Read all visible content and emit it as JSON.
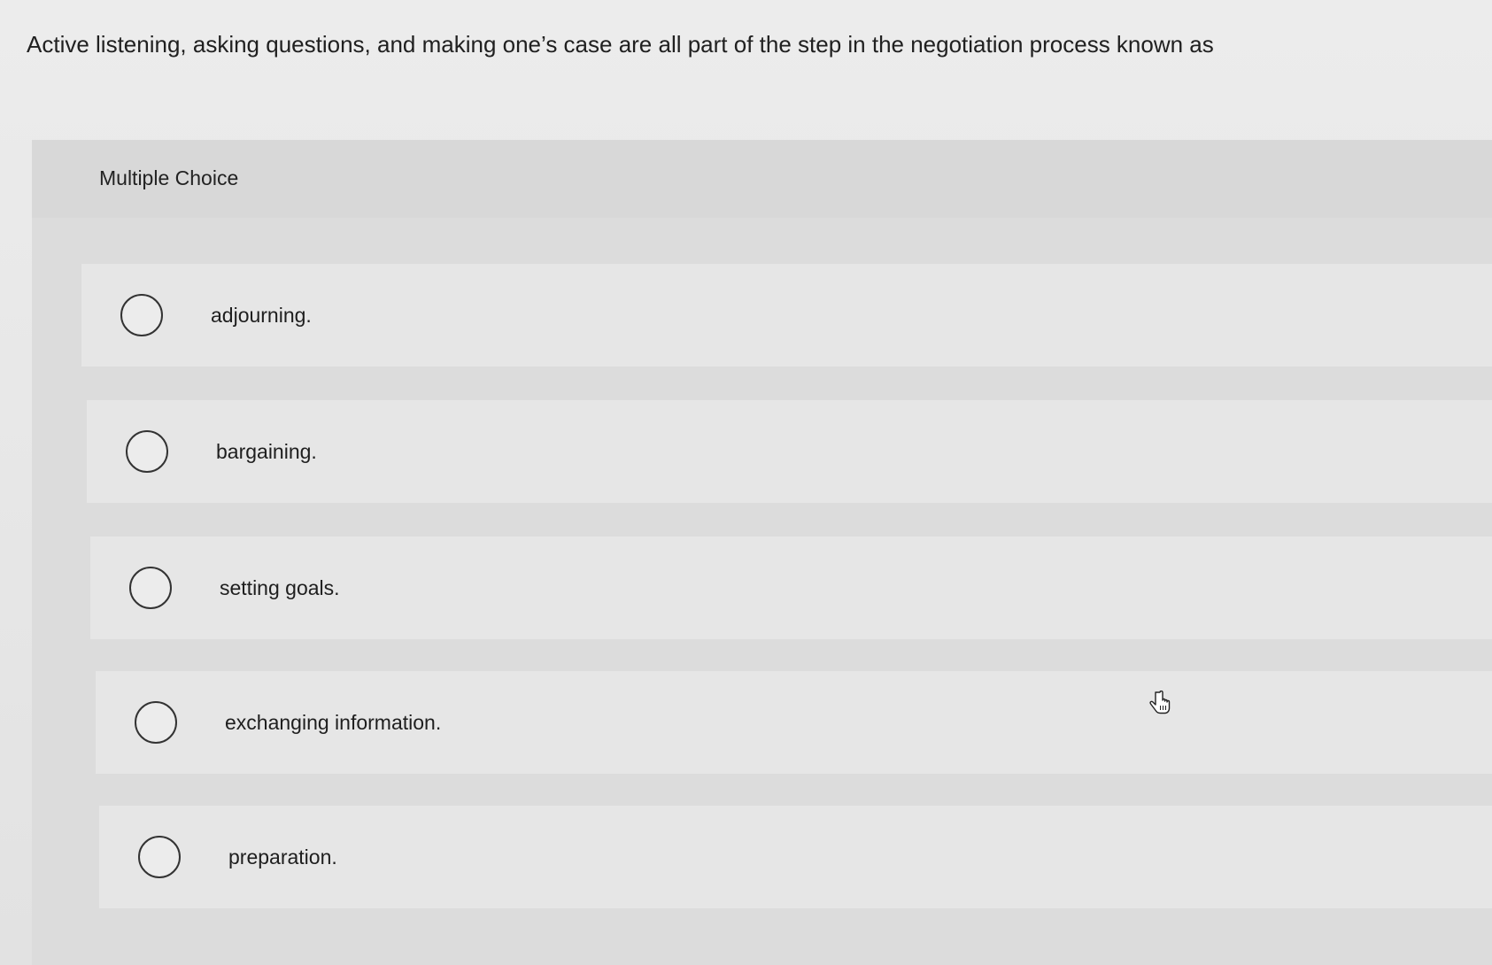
{
  "question": {
    "text": "Active listening, asking questions, and making one’s case are all part of the step in the negotiation process known as"
  },
  "panel": {
    "label": "Multiple Choice"
  },
  "choices": [
    {
      "label": "adjourning."
    },
    {
      "label": "bargaining."
    },
    {
      "label": "setting goals."
    },
    {
      "label": "exchanging information."
    },
    {
      "label": "preparation."
    }
  ],
  "cursor_icon": "hand-pointer-icon"
}
